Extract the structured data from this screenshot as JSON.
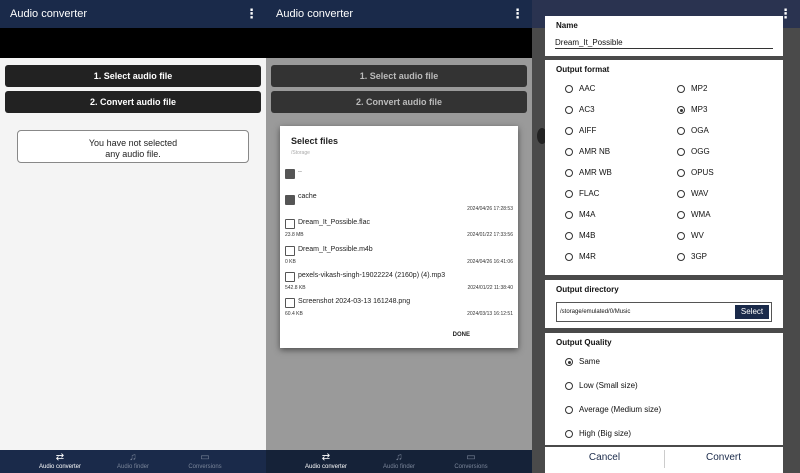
{
  "panel1": {
    "app_title": "Audio converter",
    "btn_select": "1. Select audio file",
    "btn_convert": "2. Convert audio file",
    "notice_line1": "You have not selected",
    "notice_line2": "any audio file.",
    "nav": [
      {
        "label": "Audio converter",
        "icon": "swap-icon"
      },
      {
        "label": "Audio finder",
        "icon": "music-icon"
      },
      {
        "label": "Conversions",
        "icon": "briefcase-icon"
      }
    ]
  },
  "panel2": {
    "app_title": "Audio converter",
    "btn_select": "1. Select audio file",
    "btn_convert": "2. Convert audio file",
    "dialog": {
      "title": "Select files",
      "subtitle": "/Storage",
      "done": "DONE",
      "files": [
        {
          "name": "..",
          "type": "folder",
          "size": "",
          "date": ""
        },
        {
          "name": "cache",
          "type": "folder",
          "size": "",
          "date": "2024/04/26 17:28:53"
        },
        {
          "name": "Dream_It_Possible.flac",
          "type": "file",
          "size": "23.8 MB",
          "date": "2024/01/22 17:33:56"
        },
        {
          "name": "Dream_It_Possible.m4b",
          "type": "file",
          "size": "0 KB",
          "date": "2024/04/26 16:41:06"
        },
        {
          "name": "pexels-vikash-singh-19022224 (2160p) (4).mp3",
          "type": "file",
          "size": "542.8 KB",
          "date": "2024/01/22 11:38:40"
        },
        {
          "name": "Screenshot 2024-03-13 161248.png",
          "type": "file",
          "size": "60.4 KB",
          "date": "2024/03/13 16:12:51"
        }
      ]
    },
    "nav": [
      {
        "label": "Audio converter"
      },
      {
        "label": "Audio finder"
      },
      {
        "label": "Conversions"
      }
    ]
  },
  "panel3": {
    "name_label": "Name",
    "name_value": "Dream_It_Possible",
    "format_label": "Output format",
    "formats_left": [
      "AAC",
      "AC3",
      "AIFF",
      "AMR NB",
      "AMR WB",
      "FLAC",
      "M4A",
      "M4B",
      "M4R"
    ],
    "formats_right": [
      "MP2",
      "MP3",
      "OGA",
      "OGG",
      "OPUS",
      "WAV",
      "WMA",
      "WV",
      "3GP"
    ],
    "selected_format": "MP3",
    "dir_label": "Output directory",
    "dir_value": "/storage/emulated/0/Music",
    "select_btn": "Select",
    "quality_label": "Output Quality",
    "qualities": [
      "Same",
      "Low (Small size)",
      "Average (Medium size)",
      "High (Big size)"
    ],
    "selected_quality": "Same",
    "cancel": "Cancel",
    "convert": "Convert"
  }
}
